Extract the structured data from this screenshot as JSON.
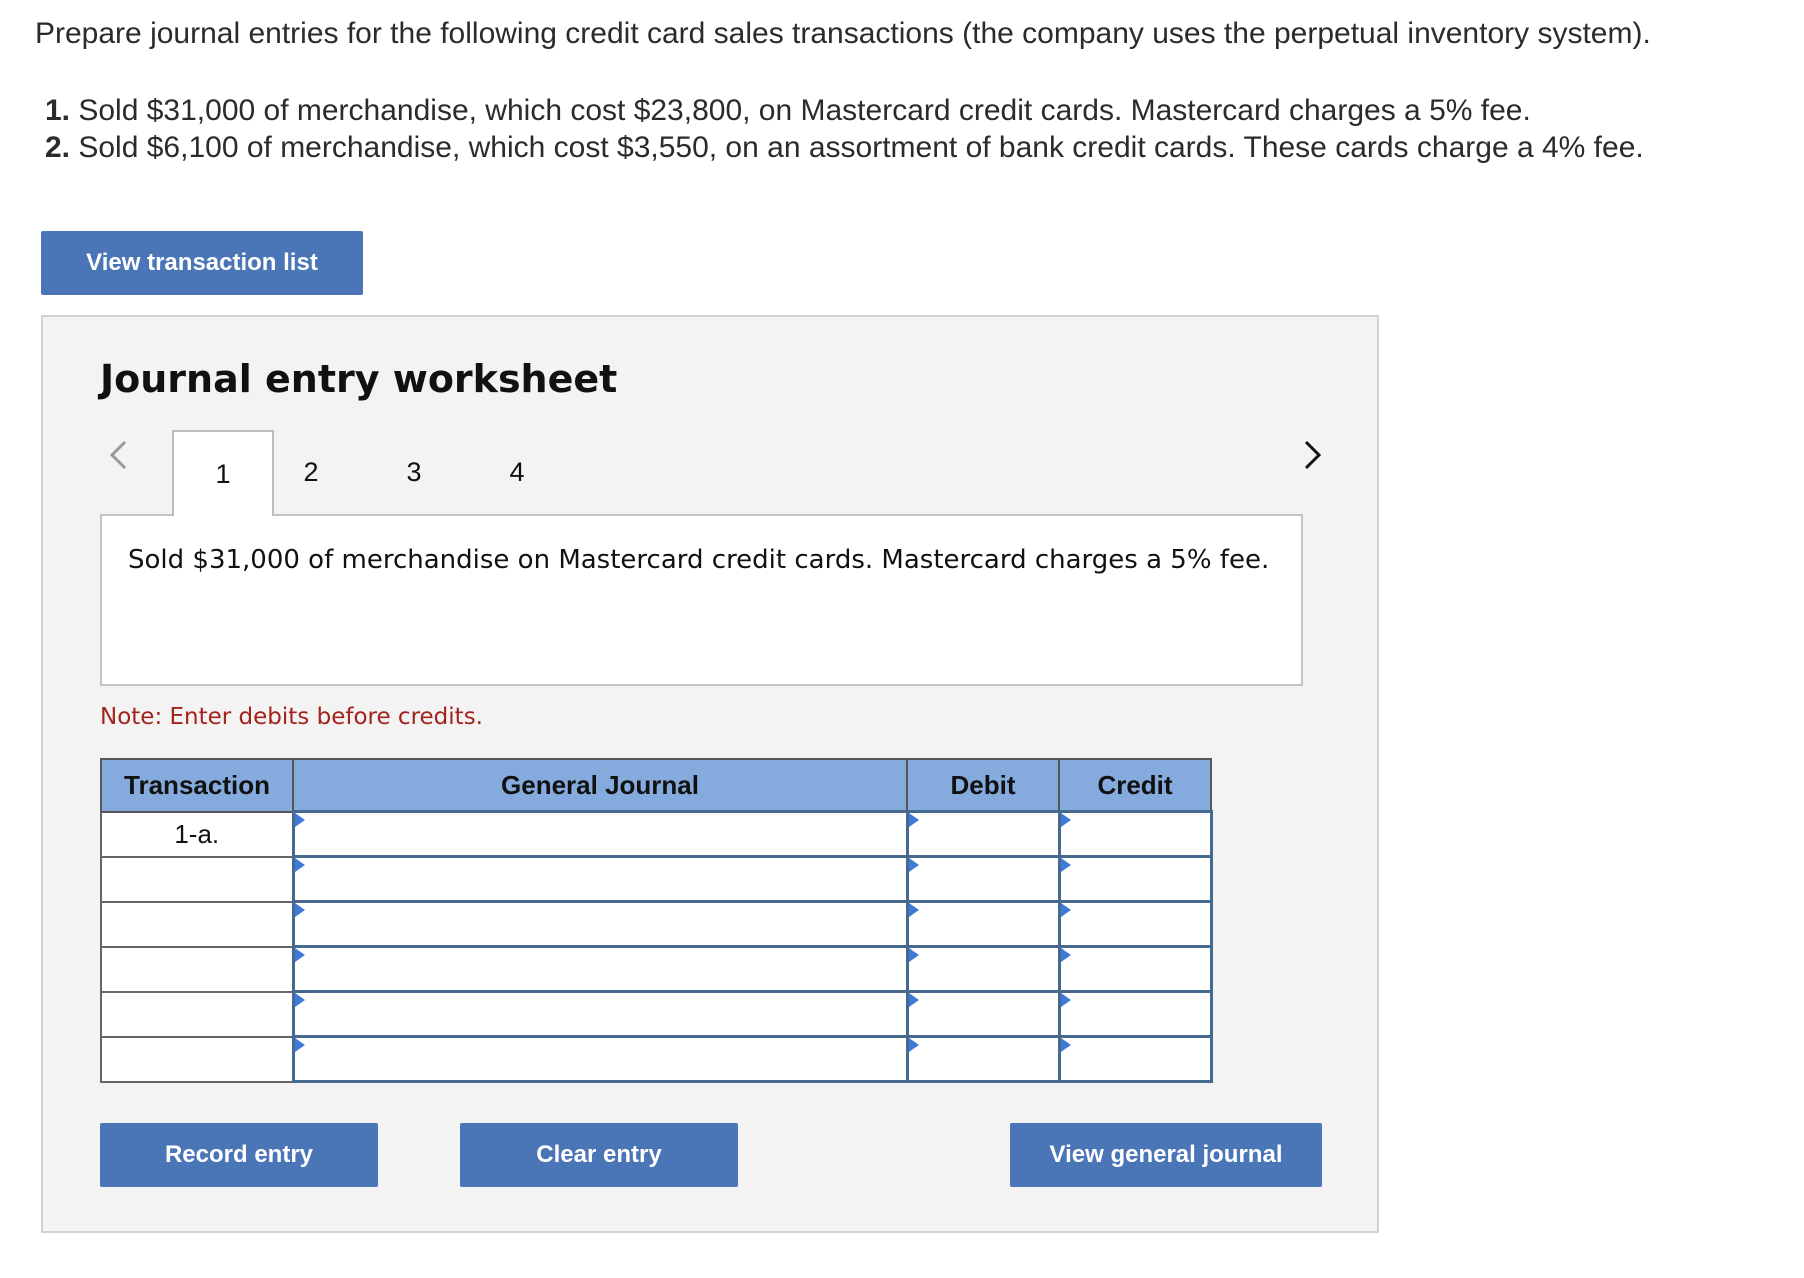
{
  "instructions": "Prepare journal entries for the following credit card sales transactions (the company uses the perpetual inventory system).",
  "transactions": [
    {
      "num": "1.",
      "text": " Sold $31,000 of merchandise, which cost $23,800, on Mastercard credit cards. Mastercard charges a 5% fee."
    },
    {
      "num": "2.",
      "text": " Sold $6,100 of merchandise, which cost $3,550, on an assortment of bank credit cards. These cards charge a 4% fee."
    }
  ],
  "buttons": {
    "view_transaction_list": "View transaction list",
    "record_entry": "Record entry",
    "clear_entry": "Clear entry",
    "view_general_journal": "View general journal"
  },
  "worksheet": {
    "title": "Journal entry worksheet",
    "tabs": [
      "1",
      "2",
      "3",
      "4"
    ],
    "active_tab": "1",
    "description": "Sold $31,000 of merchandise on Mastercard credit cards. Mastercard charges a 5% fee.",
    "note": "Note: Enter debits before credits."
  },
  "journal": {
    "headers": {
      "transaction": "Transaction",
      "general_journal": "General Journal",
      "debit": "Debit",
      "credit": "Credit"
    },
    "rows": [
      {
        "transaction": "1-a.",
        "account": "",
        "debit": "",
        "credit": ""
      },
      {
        "transaction": "",
        "account": "",
        "debit": "",
        "credit": ""
      },
      {
        "transaction": "",
        "account": "",
        "debit": "",
        "credit": ""
      },
      {
        "transaction": "",
        "account": "",
        "debit": "",
        "credit": ""
      },
      {
        "transaction": "",
        "account": "",
        "debit": "",
        "credit": ""
      },
      {
        "transaction": "",
        "account": "",
        "debit": "",
        "credit": ""
      }
    ]
  },
  "colors": {
    "button": "#4a76b8",
    "header": "#85aade",
    "note": "#a3231c",
    "panel": "#f3f3f3"
  },
  "icons": {
    "prev": "chevron-left-icon",
    "next": "chevron-right-icon"
  }
}
